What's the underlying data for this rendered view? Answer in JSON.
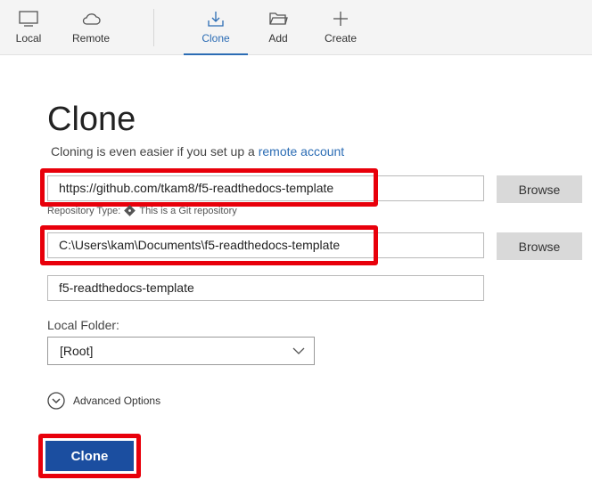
{
  "toolbar": {
    "items": [
      {
        "label": "Local",
        "icon": "monitor-icon"
      },
      {
        "label": "Remote",
        "icon": "cloud-icon"
      },
      {
        "label": "Clone",
        "icon": "download-icon",
        "active": true
      },
      {
        "label": "Add",
        "icon": "folder-icon"
      },
      {
        "label": "Create",
        "icon": "plus-icon"
      }
    ]
  },
  "page": {
    "title": "Clone",
    "subtitle_prefix": "Cloning is even easier if you set up a ",
    "subtitle_link": "remote account"
  },
  "form": {
    "source_url": "https://github.com/tkam8/f5-readthedocs-template",
    "browse_label": "Browse",
    "repo_type_label": "Repository Type:",
    "repo_type_value": "This is a Git repository",
    "destination_path": "C:\\Users\\kam\\Documents\\f5-readthedocs-template",
    "name": "f5-readthedocs-template",
    "local_folder_label": "Local Folder:",
    "local_folder_value": "[Root]",
    "advanced_options_label": "Advanced Options",
    "clone_button_label": "Clone"
  },
  "colors": {
    "accent": "#2b6cb4",
    "primary_button": "#1b4ea0",
    "highlight": "#e8000b"
  }
}
